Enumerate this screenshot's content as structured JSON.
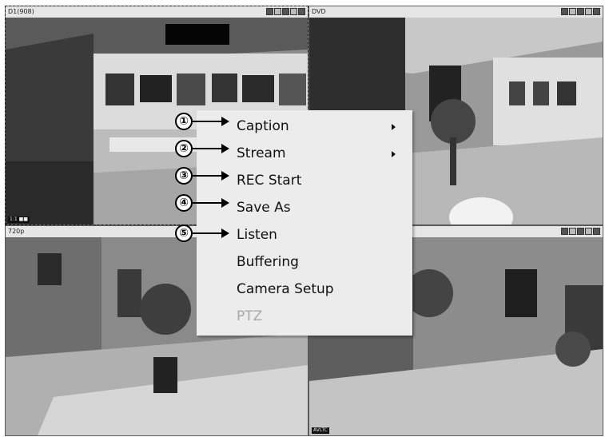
{
  "cameras": [
    {
      "name": "D1(908)",
      "osd": "1:1 ■■"
    },
    {
      "name": "DVD"
    },
    {
      "name": "720p"
    },
    {
      "name": "",
      "osd": "AVLTC"
    }
  ],
  "context_menu": {
    "items": [
      {
        "label": "Caption",
        "submenu": true
      },
      {
        "label": "Stream",
        "submenu": true
      },
      {
        "label": "REC Start"
      },
      {
        "label": "Save As"
      },
      {
        "label": "Listen"
      },
      {
        "label": "Buffering"
      },
      {
        "label": "Camera Setup"
      },
      {
        "label": "PTZ",
        "disabled": true
      }
    ]
  },
  "callouts": [
    "①",
    "②",
    "③",
    "④",
    "⑤"
  ]
}
